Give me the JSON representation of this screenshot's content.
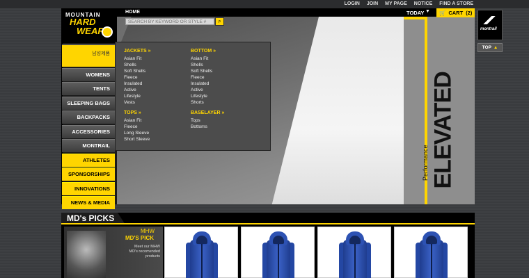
{
  "top_links": [
    "LOGIN",
    "JOIN",
    "MY PAGE",
    "NOTICE",
    "FIND A STORE"
  ],
  "logo": {
    "line1": "MOUNTAIN",
    "line2": "HARD",
    "line3": "WEAR"
  },
  "breadcrumb": "HOME",
  "search": {
    "placeholder": "SEARCH BY KEYWORD OR STYLE #"
  },
  "today_label": "TODAY",
  "cart": {
    "label": "CART",
    "count": "(2)"
  },
  "nav": {
    "items": [
      "남성제품",
      "WOMENS",
      "TENTS",
      "SLEEPING BAGS",
      "BACKPACKS",
      "ACCESSORIES",
      "MONTRAIL",
      "ATHLETES",
      "SPONSORSHIPS",
      "INNOVATIONS",
      "NEWS & MEDIA"
    ]
  },
  "dropdown": {
    "jackets": {
      "title": "JACKETS »",
      "links": [
        "Asian Fit",
        "Shells",
        "Soft Shells",
        "Fleece",
        "Insulated",
        "Active",
        "Lifestyle",
        "Vests"
      ]
    },
    "tops": {
      "title": "TOPS »",
      "links": [
        "Asian Fit",
        "Fleece",
        "Long Sleeve",
        "Short Sleeve"
      ]
    },
    "bottom": {
      "title": "BOTTOM »",
      "links": [
        "Asian Fit",
        "Shells",
        "Soft Shells",
        "Fleece",
        "Insulated",
        "Active",
        "Lifestyle",
        "Shorts"
      ]
    },
    "baselayer": {
      "title": "BASELAYER »",
      "links": [
        "Tops",
        "Bottoms"
      ]
    }
  },
  "hero": {
    "headline": "ELEVATED",
    "subhead": "Performance"
  },
  "montrail": "montrail",
  "top_button": "TOP",
  "picks": {
    "title": "MD's PICKS",
    "promo_line1": "MHW",
    "promo_line2": "MD'S PICK",
    "promo_text": "Meet our MHW MD's recomended products"
  },
  "colors": {
    "accent": "#ffd500",
    "background": "#3a3c3f",
    "product_blue": "#3b62c7"
  }
}
